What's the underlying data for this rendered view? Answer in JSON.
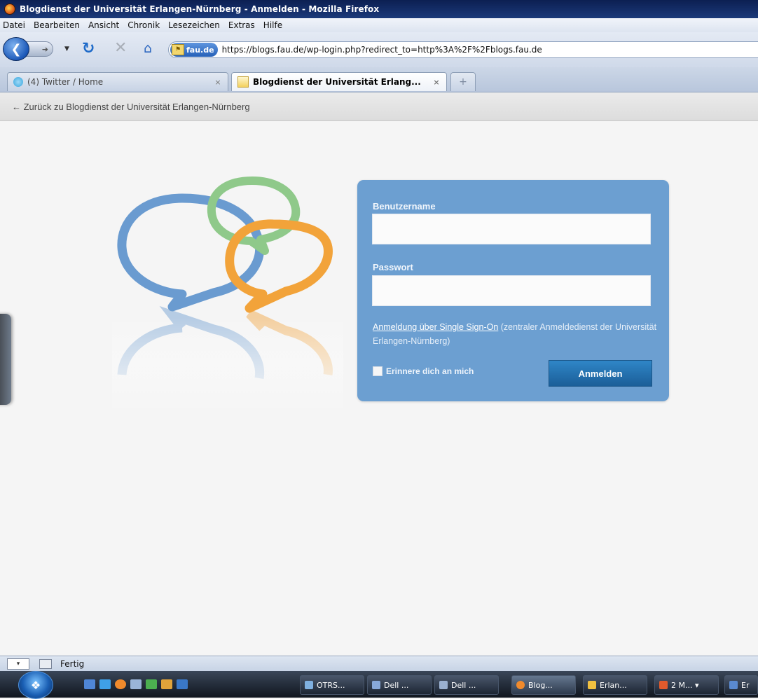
{
  "window": {
    "title": "Blogdienst der Universität Erlangen-Nürnberg - Anmelden - Mozilla Firefox"
  },
  "menubar": {
    "items": [
      "Datei",
      "Bearbeiten",
      "Ansicht",
      "Chronik",
      "Lesezeichen",
      "Extras",
      "Hilfe"
    ]
  },
  "navbar": {
    "back_icon": "back-arrow-icon",
    "reload_icon": "reload-icon",
    "stop_icon": "stop-icon",
    "home_icon": "home-icon",
    "site_badge": "fau.de",
    "url": "https://blogs.fau.de/wp-login.php?redirect_to=http%3A%2F%2Fblogs.fau.de"
  },
  "tabs": [
    {
      "label": "(4) Twitter / Home",
      "close": "×",
      "active": false
    },
    {
      "label": "Blogdienst der Universität Erlang...",
      "close": "×",
      "active": true
    }
  ],
  "new_tab_label": "+",
  "adminbar": {
    "back_link": "← Zurück zu Blogdienst der Universität Erlangen-Nürnberg"
  },
  "login": {
    "username_label": "Benutzername",
    "username_value": "",
    "password_label": "Passwort",
    "password_value": "",
    "sso_link": "Anmeldung über Single Sign-On",
    "sso_text": " (zentraler Anmeldedienst der Universität Erlangen-Nürnberg)",
    "remember_label": "Erinnere dich an mich",
    "remember_checked": false,
    "submit_label": "Anmelden",
    "box_color": "#6c9fd1"
  },
  "logo": {
    "colors": [
      "#6a9bd0",
      "#8fc98a",
      "#f2a33a"
    ]
  },
  "statusbar": {
    "text": "Fertig"
  },
  "taskbar": {
    "buttons": [
      {
        "label": "OTRS...",
        "icon_color": "#7fb0e0"
      },
      {
        "label": "Dell ...",
        "icon_color": "#88a8d8"
      },
      {
        "label": "Dell ...",
        "icon_color": "#9ab0d0"
      },
      {
        "label": "Blog...",
        "icon_color": "#f08a2c"
      },
      {
        "label": "Erlan...",
        "icon_color": "#f0c040"
      },
      {
        "label": "2 M... ▾",
        "icon_color": "#e05a2c"
      },
      {
        "label": "Er",
        "icon_color": "#5a8ad0"
      }
    ]
  }
}
